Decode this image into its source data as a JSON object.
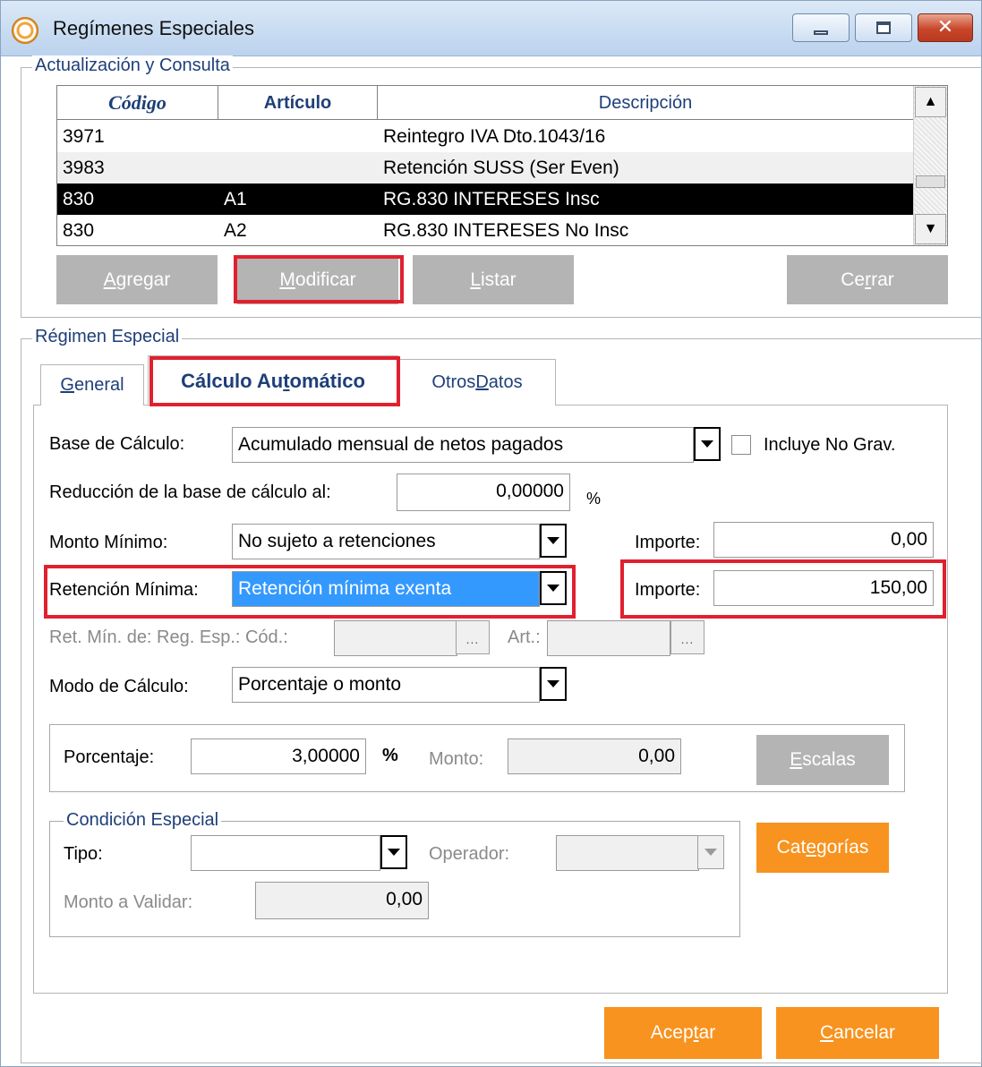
{
  "window": {
    "title": "Regímenes Especiales",
    "controls": {
      "minimize": "minimize-icon",
      "maximize": "maximize-icon",
      "close": "close-icon"
    }
  },
  "consulta": {
    "legend": "Actualización y Consulta",
    "columns": [
      "Código",
      "Artículo",
      "Descripción"
    ],
    "rows": [
      {
        "codigo": "3971",
        "articulo": "",
        "descripcion": "Reintegro IVA Dto.1043/16"
      },
      {
        "codigo": "3983",
        "articulo": "",
        "descripcion": "Retención SUSS (Ser Even)"
      },
      {
        "codigo": "830",
        "articulo": "A1",
        "descripcion": "RG.830 INTERESES Insc"
      },
      {
        "codigo": "830",
        "articulo": "A2",
        "descripcion": "RG.830 INTERESES No Insc"
      }
    ],
    "selected_row": 2,
    "buttons": {
      "agregar": {
        "pre": "",
        "ul": "A",
        "post": "gregar"
      },
      "modificar": {
        "pre": "",
        "ul": "M",
        "post": "odificar"
      },
      "listar": {
        "pre": "",
        "ul": "L",
        "post": "istar"
      },
      "cerrar": {
        "pre": "Ce",
        "ul": "r",
        "post": "rar"
      }
    }
  },
  "regimen": {
    "legend": "Régimen Especial",
    "tabs": [
      {
        "pre": "",
        "ul": "G",
        "post": "eneral"
      },
      {
        "pre": "Cálculo Au",
        "ul": "t",
        "post": "omático"
      },
      {
        "pre": "Otros ",
        "ul": "D",
        "post": "atos"
      }
    ],
    "active_tab": 1,
    "base_calculo": {
      "label": "Base de Cálculo:",
      "value": "Acumulado mensual de netos pagados",
      "checkbox_label": "Incluye No Grav.",
      "checked": false
    },
    "reduccion": {
      "label": "Reducción de la base de cálculo al:",
      "value": "0,00000",
      "unit": "%"
    },
    "monto_minimo": {
      "label": "Monto Mínimo:",
      "value": "No sujeto a retenciones",
      "importe_label": "Importe:",
      "importe": "0,00"
    },
    "retencion_minima": {
      "label": "Retención Mínima:",
      "value": "Retención mínima exenta",
      "importe_label": "Importe:",
      "importe": "150,00"
    },
    "ret_min_reg": {
      "label": "Ret. Mín. de: Reg. Esp.: Cód.:",
      "dots": "...",
      "art_label": "Art.:",
      "art_dots": "..."
    },
    "modo_calculo": {
      "label": "Modo de Cálculo:",
      "value": "Porcentaje o monto"
    },
    "porcentaje": {
      "label": "Porcentaje:",
      "value": "3,00000",
      "unit": "%",
      "monto_label": "Monto:",
      "monto": "0,00",
      "escalas": {
        "pre": "",
        "ul": "E",
        "post": "scalas"
      }
    },
    "condicion": {
      "legend": "Condición Especial",
      "tipo_label": "Tipo:",
      "tipo_value": "",
      "operador_label": "Operador:",
      "operador_value": "",
      "monto_label": "Monto a Validar:",
      "monto": "0,00",
      "categorias": {
        "pre": "Cat",
        "ul": "e",
        "post": "gorías"
      }
    }
  },
  "footer": {
    "aceptar": {
      "pre": "Acep",
      "ul": "t",
      "post": "ar"
    },
    "cancelar": {
      "pre": "",
      "ul": "C",
      "post": "ancelar"
    }
  },
  "colors": {
    "accent_orange": "#f7931e",
    "highlight_red": "#e0202f",
    "disabled_grey": "#b4b4b4",
    "selection_blue": "#3399ff",
    "legend_blue": "#1e3f78"
  }
}
